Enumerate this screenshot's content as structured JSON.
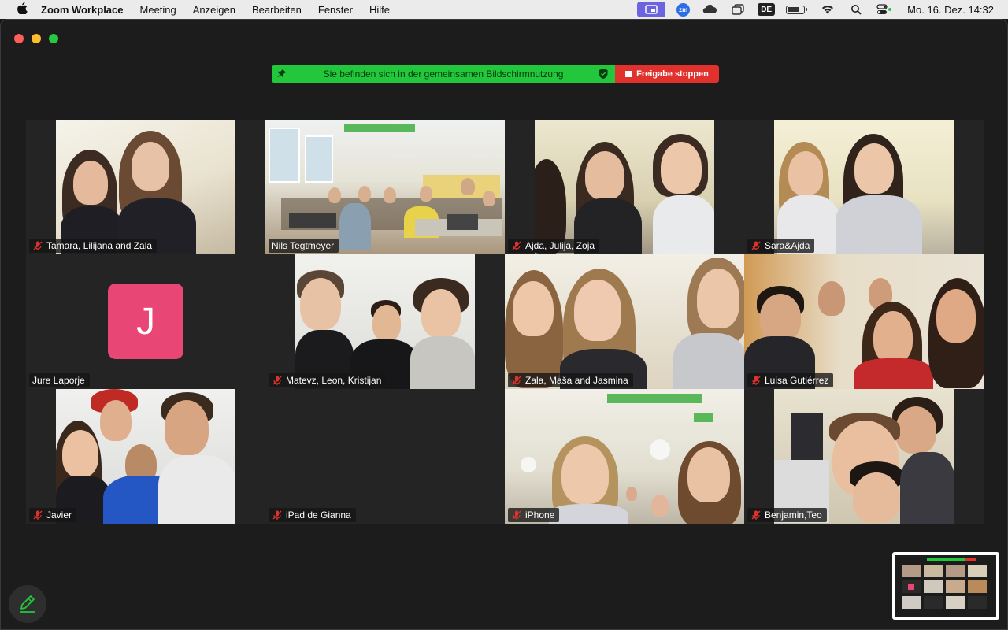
{
  "menubar": {
    "apple": "",
    "app_name": "Zoom Workplace",
    "items": [
      "Meeting",
      "Anzeigen",
      "Bearbeiten",
      "Fenster",
      "Hilfe"
    ],
    "zm_badge": "zm",
    "input_source": "DE",
    "clock": "Mo. 16. Dez.  14:32"
  },
  "share": {
    "message": "Sie befinden sich in der gemeinsamen Bildschirmnutzung",
    "stop_label": "Freigabe stoppen",
    "green": "#22c73b",
    "red": "#e1312d"
  },
  "participants": [
    {
      "name": "Tamara, Lilijana and Zala",
      "muted": true
    },
    {
      "name": "Nils Tegtmeyer",
      "muted": false,
      "active_speaker": true
    },
    {
      "name": "Ajda, Julija, Zoja",
      "muted": true
    },
    {
      "name": "Sara&Ajda",
      "muted": true
    },
    {
      "name": "Jure Laporje",
      "muted": false,
      "avatar_letter": "J",
      "avatar_color": "#e84675"
    },
    {
      "name": "Matevz, Leon, Kristijan",
      "muted": true
    },
    {
      "name": "Zala, Maša and Jasmina",
      "muted": true
    },
    {
      "name": "Luisa Gutiérrez",
      "muted": true
    },
    {
      "name": "Javier",
      "muted": true
    },
    {
      "name": "iPad de Gianna",
      "muted": true
    },
    {
      "name": "iPhone",
      "muted": true
    },
    {
      "name": "Benjamin,Teo",
      "muted": true
    }
  ],
  "icons": {
    "mic_muted": "mic-muted-icon",
    "pencil": "pencil-icon",
    "pin": "pin-icon",
    "shield": "shield-icon"
  }
}
